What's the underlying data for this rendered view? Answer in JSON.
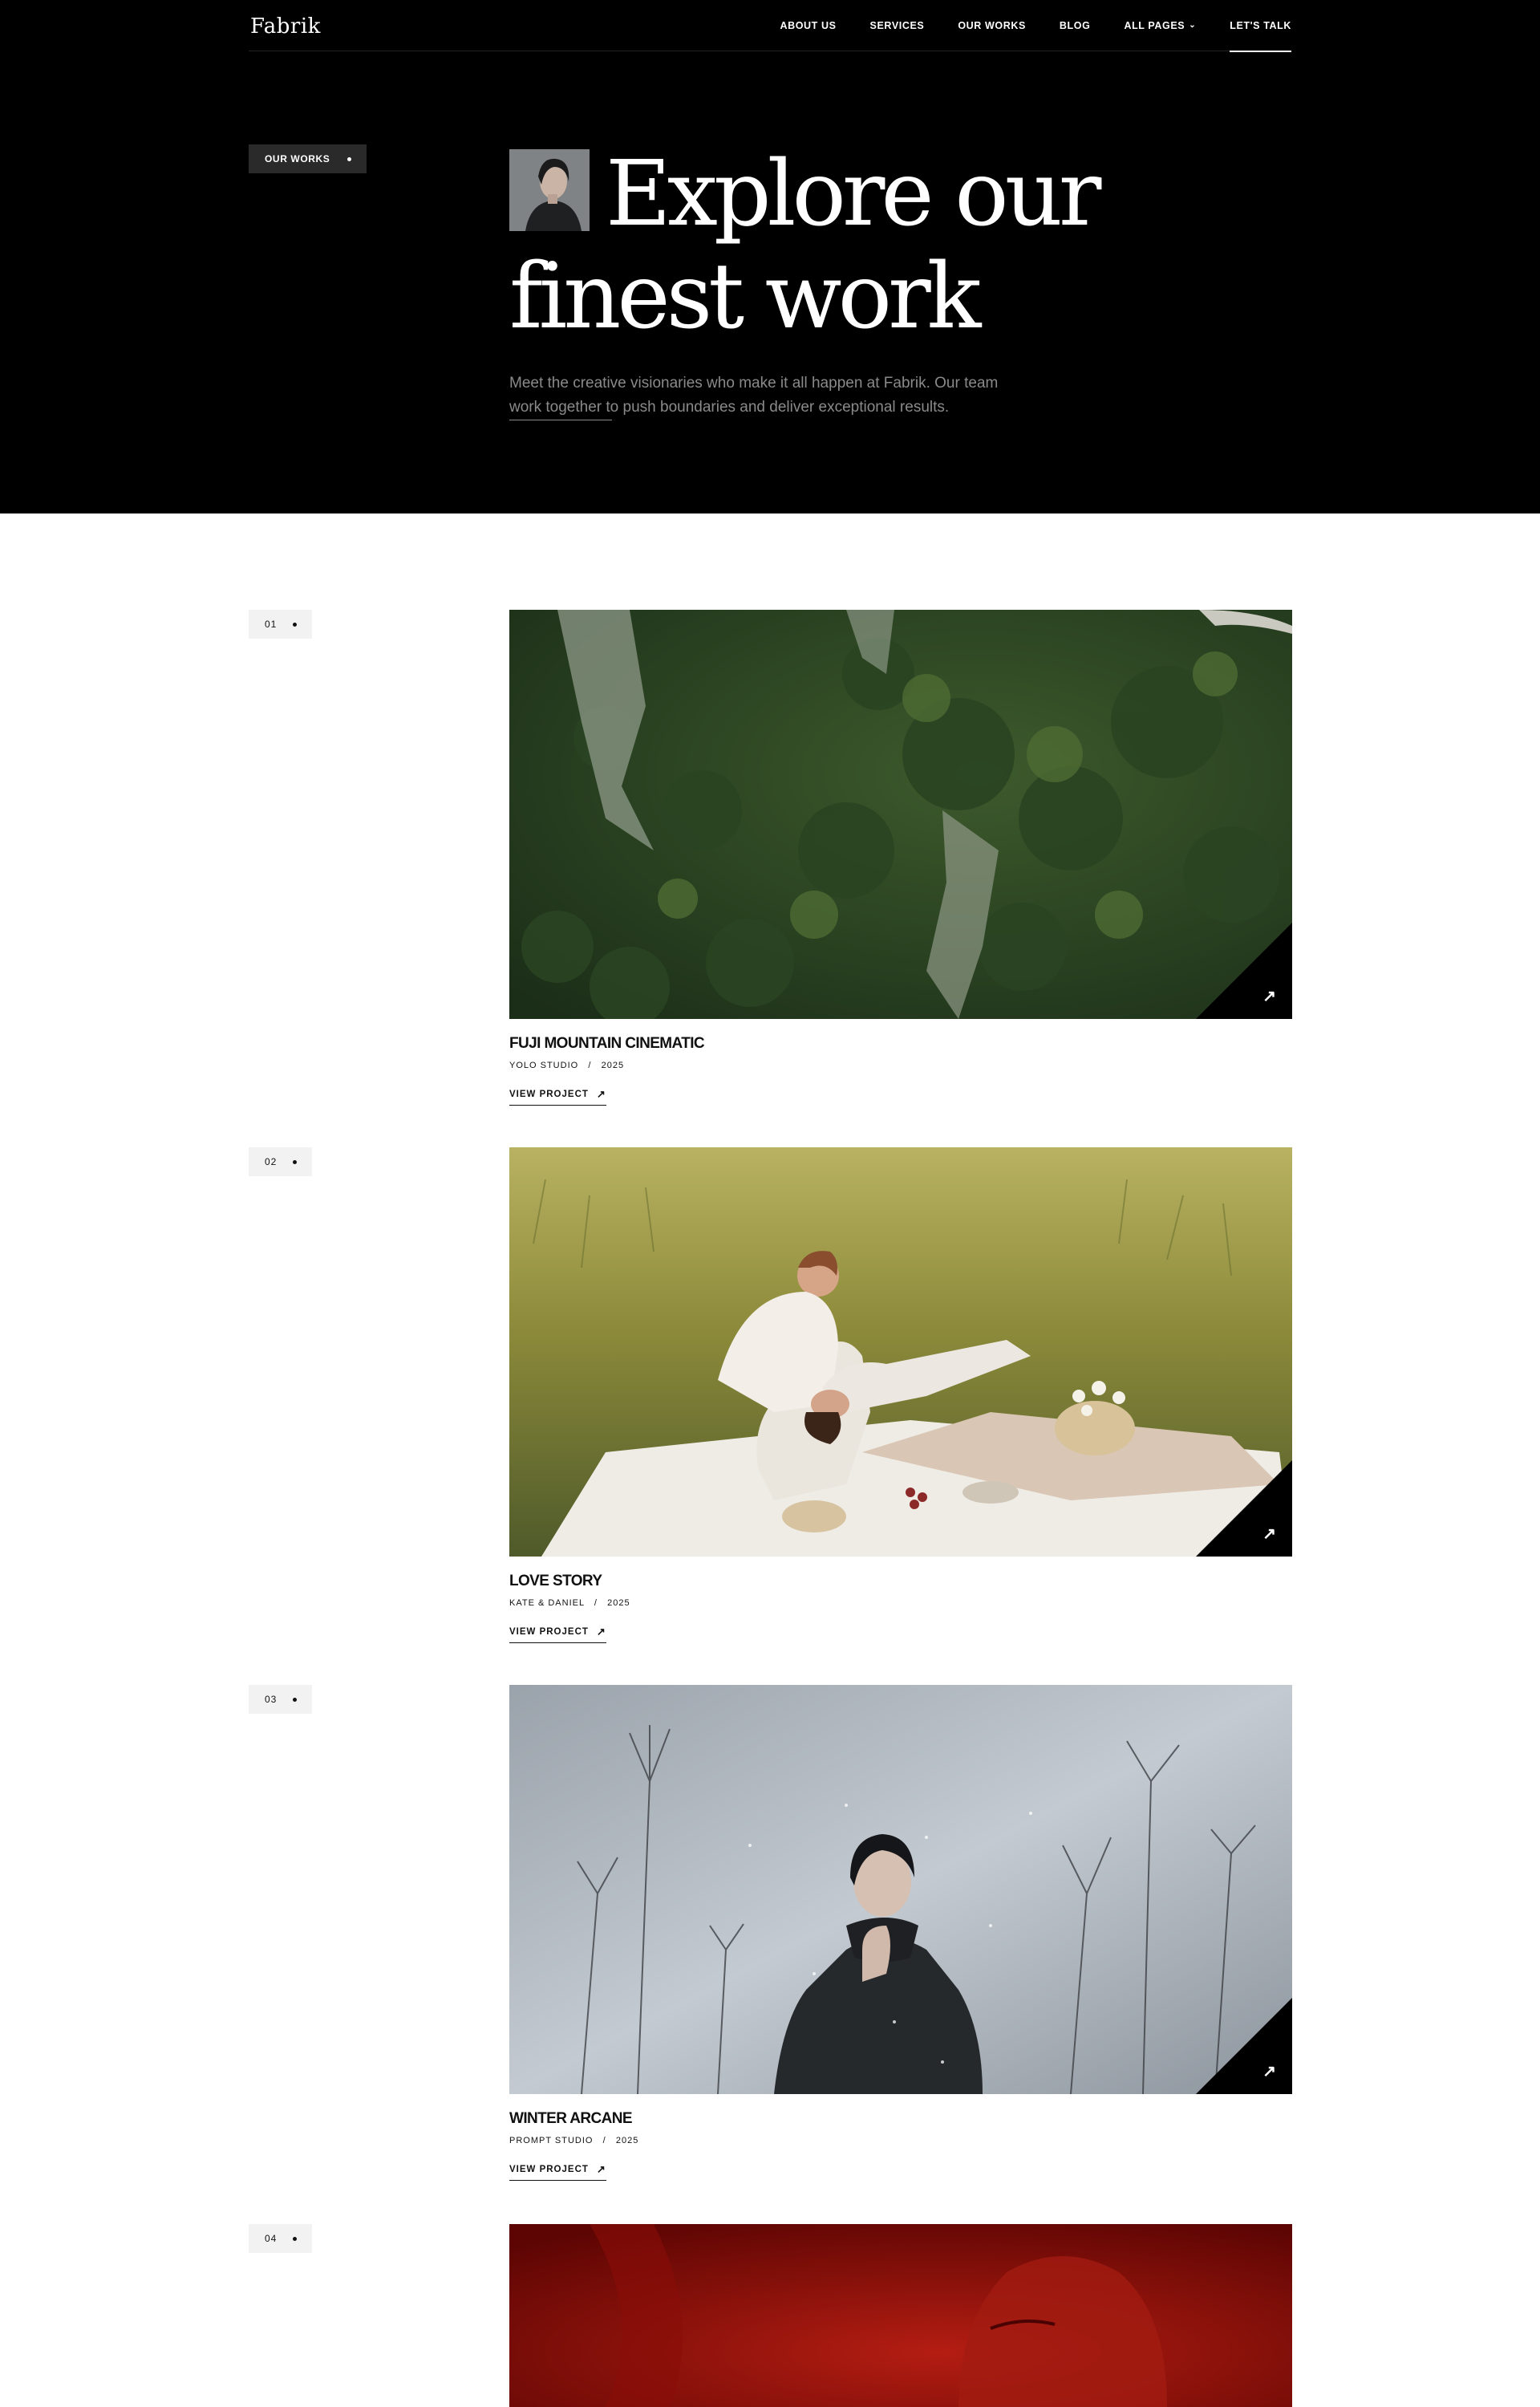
{
  "brand": {
    "logo": "Fabrik"
  },
  "nav": {
    "items": [
      {
        "label": "ABOUT US"
      },
      {
        "label": "SERVICES"
      },
      {
        "label": "OUR WORKS"
      },
      {
        "label": "BLOG"
      },
      {
        "label": "ALL PAGES",
        "has_dropdown": true
      }
    ],
    "cta": "LET'S TALK"
  },
  "hero": {
    "badge": "OUR WORKS",
    "title_line1": "Explore our",
    "title_line2": "finest work",
    "subtitle": "Meet the creative visionaries who make it all happen at Fabrik. Our team work together to push boundaries and deliver exceptional results."
  },
  "projects": [
    {
      "number": "01",
      "title": "FUJI MOUNTAIN CINEMATIC",
      "client": "YOLO STUDIO",
      "year": "2025",
      "link": "VIEW PROJECT",
      "image": "aerial-forest-cliff"
    },
    {
      "number": "02",
      "title": "LOVE STORY",
      "client": "KATE & DANIEL",
      "year": "2025",
      "link": "VIEW PROJECT",
      "image": "couple-picnic-grass"
    },
    {
      "number": "03",
      "title": "WINTER ARCANE",
      "client": "PROMPT STUDIO",
      "year": "2025",
      "link": "VIEW PROJECT",
      "image": "woman-dark-coat-dried-plants"
    },
    {
      "number": "04",
      "image": "red-toned-portrait"
    }
  ],
  "colors": {
    "hero_bg": "#000000",
    "muted_text": "#8a8a8a",
    "badge_light": "#f2f2f2",
    "badge_dark": "#2a2a2a"
  },
  "icons": {
    "project_corner": "arrow-up-right-icon",
    "dropdown": "chevron-down-icon",
    "view_link": "arrow-up-right-icon"
  }
}
